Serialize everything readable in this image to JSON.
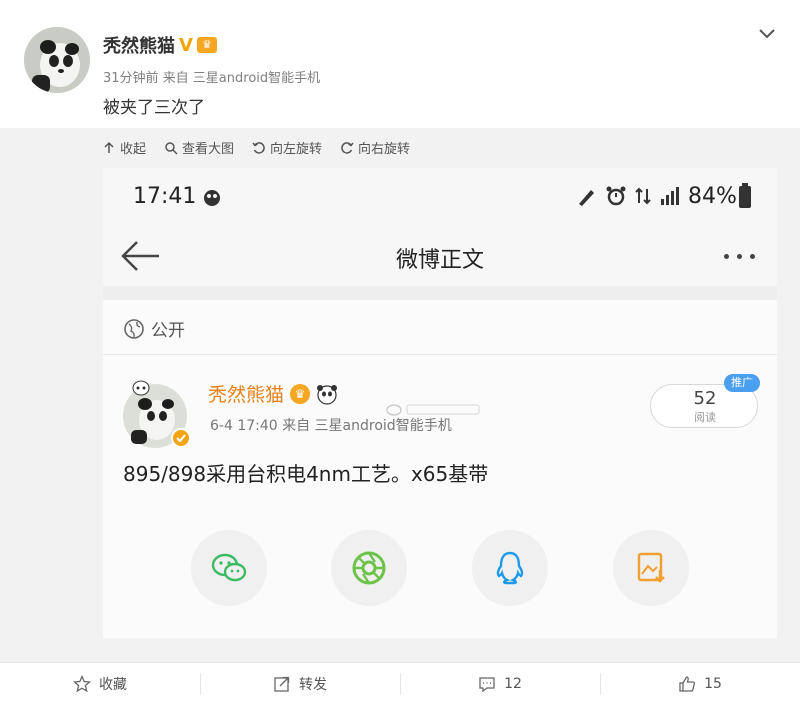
{
  "post": {
    "author": "秃然熊猫",
    "meta": "31分钟前 来自 三星android智能手机",
    "text": "被夹了三次了"
  },
  "toolbar": {
    "collapse": "收起",
    "view_large": "查看大图",
    "rotate_left": "向左旋转",
    "rotate_right": "向右旋转"
  },
  "screenshot": {
    "status": {
      "time": "17:41",
      "battery": "84%"
    },
    "nav": {
      "title": "微博正文"
    },
    "visibility": "公开",
    "card": {
      "author": "秃然熊猫",
      "meta": "6-4 17:40  来自 三星android智能手机",
      "reads_count": "52",
      "reads_label": "阅读",
      "promo_badge": "推广",
      "text": "895/898采用台积电4nm工艺。x65基带"
    },
    "share_icons": [
      "wechat-icon",
      "moments-icon",
      "qq-icon",
      "save-image-icon"
    ]
  },
  "actions": {
    "favorite": "收藏",
    "repost": "转发",
    "comments": "12",
    "likes": "15"
  },
  "colors": {
    "accent_orange": "#e8801a",
    "verified_gold": "#f2a500",
    "promo_blue": "#4a9ff0",
    "wechat_green": "#3dbb63",
    "qq_blue": "#1e9be8"
  }
}
